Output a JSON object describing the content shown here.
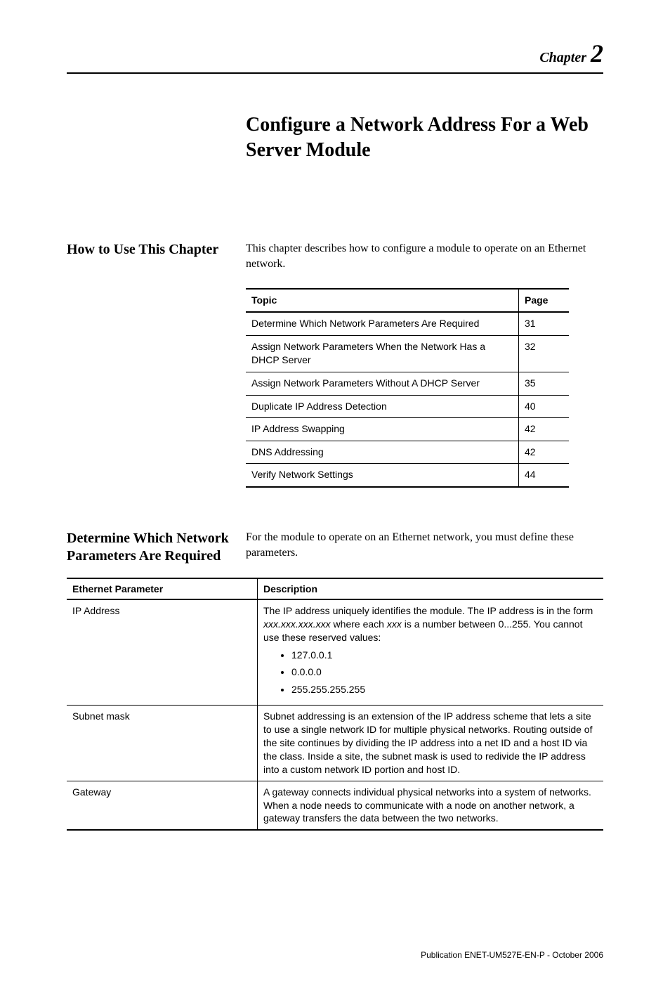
{
  "chapter": {
    "word": "Chapter",
    "number": "2"
  },
  "title": "Configure a Network Address For a Web Server Module",
  "section1": {
    "heading": "How to Use This Chapter",
    "body": "This chapter describes how to configure a module to operate on an Ethernet network."
  },
  "topic_table": {
    "headers": {
      "topic": "Topic",
      "page": "Page"
    },
    "rows": [
      {
        "topic": "Determine Which Network Parameters Are Required",
        "page": "31"
      },
      {
        "topic": "Assign Network Parameters When the Network Has a DHCP Server",
        "page": "32"
      },
      {
        "topic": "Assign Network Parameters Without A DHCP Server",
        "page": "35"
      },
      {
        "topic": "Duplicate IP Address Detection",
        "page": "40"
      },
      {
        "topic": "IP Address Swapping",
        "page": "42"
      },
      {
        "topic": "DNS Addressing",
        "page": "42"
      },
      {
        "topic": "Verify Network Settings",
        "page": "44"
      }
    ]
  },
  "section2": {
    "heading": "Determine Which Network Parameters Are Required",
    "body": "For the module to operate on an Ethernet network, you must define these parameters."
  },
  "param_table": {
    "headers": {
      "param": "Ethernet Parameter",
      "desc": "Description"
    },
    "rows": {
      "ip": {
        "param": "IP Address",
        "desc_line1_a": "The IP address uniquely identifies the module. The IP address is in the form ",
        "desc_line1_b": "xxx.xxx.xxx.xxx",
        "desc_line1_c": " where each ",
        "desc_line1_d": "xxx",
        "desc_line1_e": " is a number between 0...255. You cannot use these reserved values:",
        "reserved": [
          "127.0.0.1",
          "0.0.0.0",
          "255.255.255.255"
        ]
      },
      "subnet": {
        "param": "Subnet mask",
        "desc": "Subnet addressing is an extension of the IP address scheme that lets a site to use a single network ID for multiple physical networks. Routing outside of the site continues by dividing the IP address into a net ID and a host ID via the class. Inside a site, the subnet mask is used to redivide the IP address into a custom network ID portion and host ID."
      },
      "gateway": {
        "param": "Gateway",
        "desc": "A gateway connects individual physical networks into a system of networks. When a node needs to communicate with a node on another network, a gateway transfers the data between the two networks."
      }
    }
  },
  "footer": "Publication ENET-UM527E-EN-P - October 2006"
}
